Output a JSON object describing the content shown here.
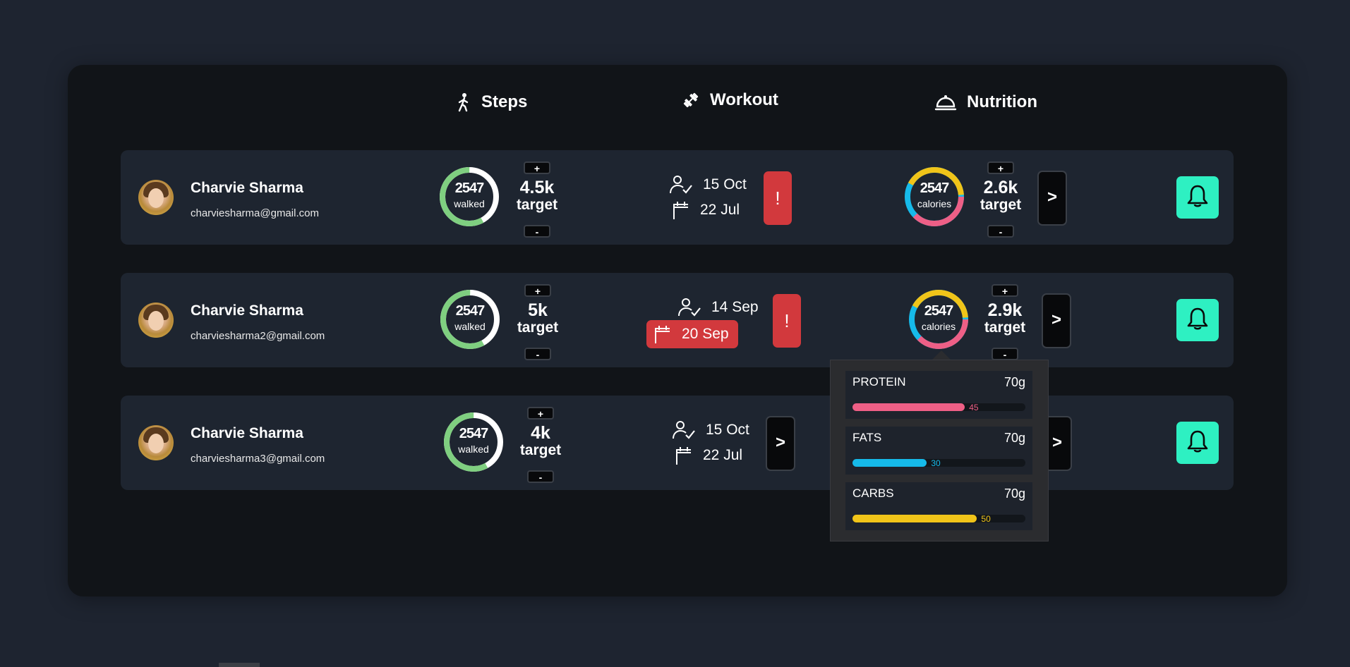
{
  "colors": {
    "steps_ring": "#7fcf80",
    "protein": "#ee5f86",
    "fats": "#16baea",
    "carbs": "#f0c419",
    "alert": "#d2393d",
    "bell": "#2ef0c2"
  },
  "header": {
    "steps": {
      "icon": "walking-person-icon",
      "label": "Steps"
    },
    "workout": {
      "icon": "dumbbell-icon",
      "label": "Workout"
    },
    "nutrition": {
      "icon": "food-cloche-icon",
      "label": "Nutrition"
    }
  },
  "rows": [
    {
      "name": "Charvie Sharma",
      "email": "charviesharma@gmail.com",
      "steps": {
        "value": "2547",
        "label": "walked",
        "progress": 0.58,
        "target": "4.5k",
        "target_label": "target",
        "plus": "+",
        "minus": "-"
      },
      "workout": {
        "done_date": "15 Oct",
        "scheduled_date": "22 Jul",
        "overdue": false,
        "action": "!"
      },
      "nutrition": {
        "value": "2547",
        "label": "calories",
        "target": "2.6k",
        "target_label": "target",
        "plus": "+",
        "minus": "-",
        "arrow": ">"
      }
    },
    {
      "name": "Charvie Sharma",
      "email": "charviesharma2@gmail.com",
      "steps": {
        "value": "2547",
        "label": "walked",
        "progress": 0.58,
        "target": "5k",
        "target_label": "target",
        "plus": "+",
        "minus": "-"
      },
      "workout": {
        "done_date": "14 Sep",
        "scheduled_date": "20 Sep",
        "overdue": true,
        "action": "!"
      },
      "nutrition": {
        "value": "2547",
        "label": "calories",
        "target": "2.9k",
        "target_label": "target",
        "plus": "+",
        "minus": "-",
        "arrow": ">"
      }
    },
    {
      "name": "Charvie Sharma",
      "email": "charviesharma3@gmail.com",
      "steps": {
        "value": "2547",
        "label": "walked",
        "progress": 0.58,
        "target": "4k",
        "target_label": "target",
        "plus": "+",
        "minus": "-"
      },
      "workout": {
        "done_date": "15 Oct",
        "scheduled_date": "22 Jul",
        "overdue": false,
        "action": ">"
      },
      "nutrition": {
        "arrow": ">"
      }
    }
  ],
  "nutrition_popup": [
    {
      "name": "PROTEIN",
      "amount": "70g",
      "value": "45",
      "fraction": 0.65,
      "color": "#ee5f86"
    },
    {
      "name": "FATS",
      "amount": "70g",
      "value": "30",
      "fraction": 0.43,
      "color": "#16baea"
    },
    {
      "name": "CARBS",
      "amount": "70g",
      "value": "50",
      "fraction": 0.72,
      "color": "#f0c419"
    }
  ]
}
